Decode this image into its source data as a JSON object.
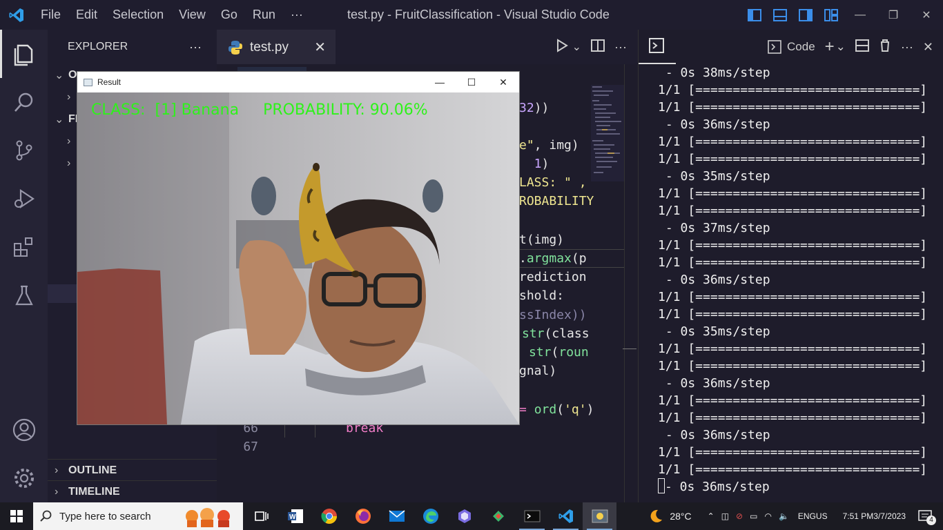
{
  "window": {
    "title": "test.py - FruitClassification - Visual Studio Code",
    "menu": [
      "File",
      "Edit",
      "Selection",
      "View",
      "Go",
      "Run",
      "···"
    ]
  },
  "sidebar": {
    "header": "EXPLORER",
    "more": "···",
    "sections": [
      {
        "label": "O"
      },
      {
        "label": "FR"
      }
    ],
    "bottom": [
      {
        "label": "OUTLINE"
      },
      {
        "label": "TIMELINE"
      }
    ]
  },
  "editor": {
    "tab_label": "test.py",
    "visible_code": [
      "32))",
      "e\", img)",
      "1)",
      "LASS: \" ,",
      "ROBABILITY",
      "t(img)",
      ".argmax(p",
      "rediction",
      "shold:",
      "ssIndex))",
      "str(class",
      "str(roun",
      "gnal)",
      "ord('q')"
    ],
    "lines": [
      {
        "number": "66",
        "code": "break"
      },
      {
        "number": "67",
        "code": ""
      }
    ]
  },
  "panel": {
    "terminal_label": "Code",
    "lines": [
      " - 0s 38ms/step",
      "1/1 [==============================]",
      "1/1 [==============================]",
      " - 0s 36ms/step",
      "1/1 [==============================]",
      "1/1 [==============================]",
      " - 0s 35ms/step",
      "1/1 [==============================]",
      "1/1 [==============================]",
      " - 0s 37ms/step",
      "1/1 [==============================]",
      "1/1 [==============================]",
      " - 0s 36ms/step",
      "1/1 [==============================]",
      "1/1 [==============================]",
      " - 0s 35ms/step",
      "1/1 [==============================]",
      "1/1 [==============================]",
      " - 0s 36ms/step",
      "1/1 [==============================]",
      "1/1 [==============================]",
      " - 0s 36ms/step",
      "1/1 [==============================]",
      "1/1 [==============================]"
    ],
    "last_line": "- 0s 36ms/step"
  },
  "result_window": {
    "title": "Result",
    "class_text": "CLASS:  [1] Banana",
    "probability_text": "PROBABILITY: 90.06%",
    "overlay_color": "#2ef21a"
  },
  "taskbar": {
    "search_placeholder": "Type here to search",
    "weather": "28°C",
    "lang_top": "ENG",
    "lang_bottom": "US",
    "time": "7:51 PM",
    "date": "3/7/2023",
    "notifications": "4"
  },
  "colors": {
    "accent": "#3b8eea",
    "titlebar_bg": "#1f1d2e",
    "activity_bg": "#252335",
    "editor_bg": "#1e1c2b"
  }
}
